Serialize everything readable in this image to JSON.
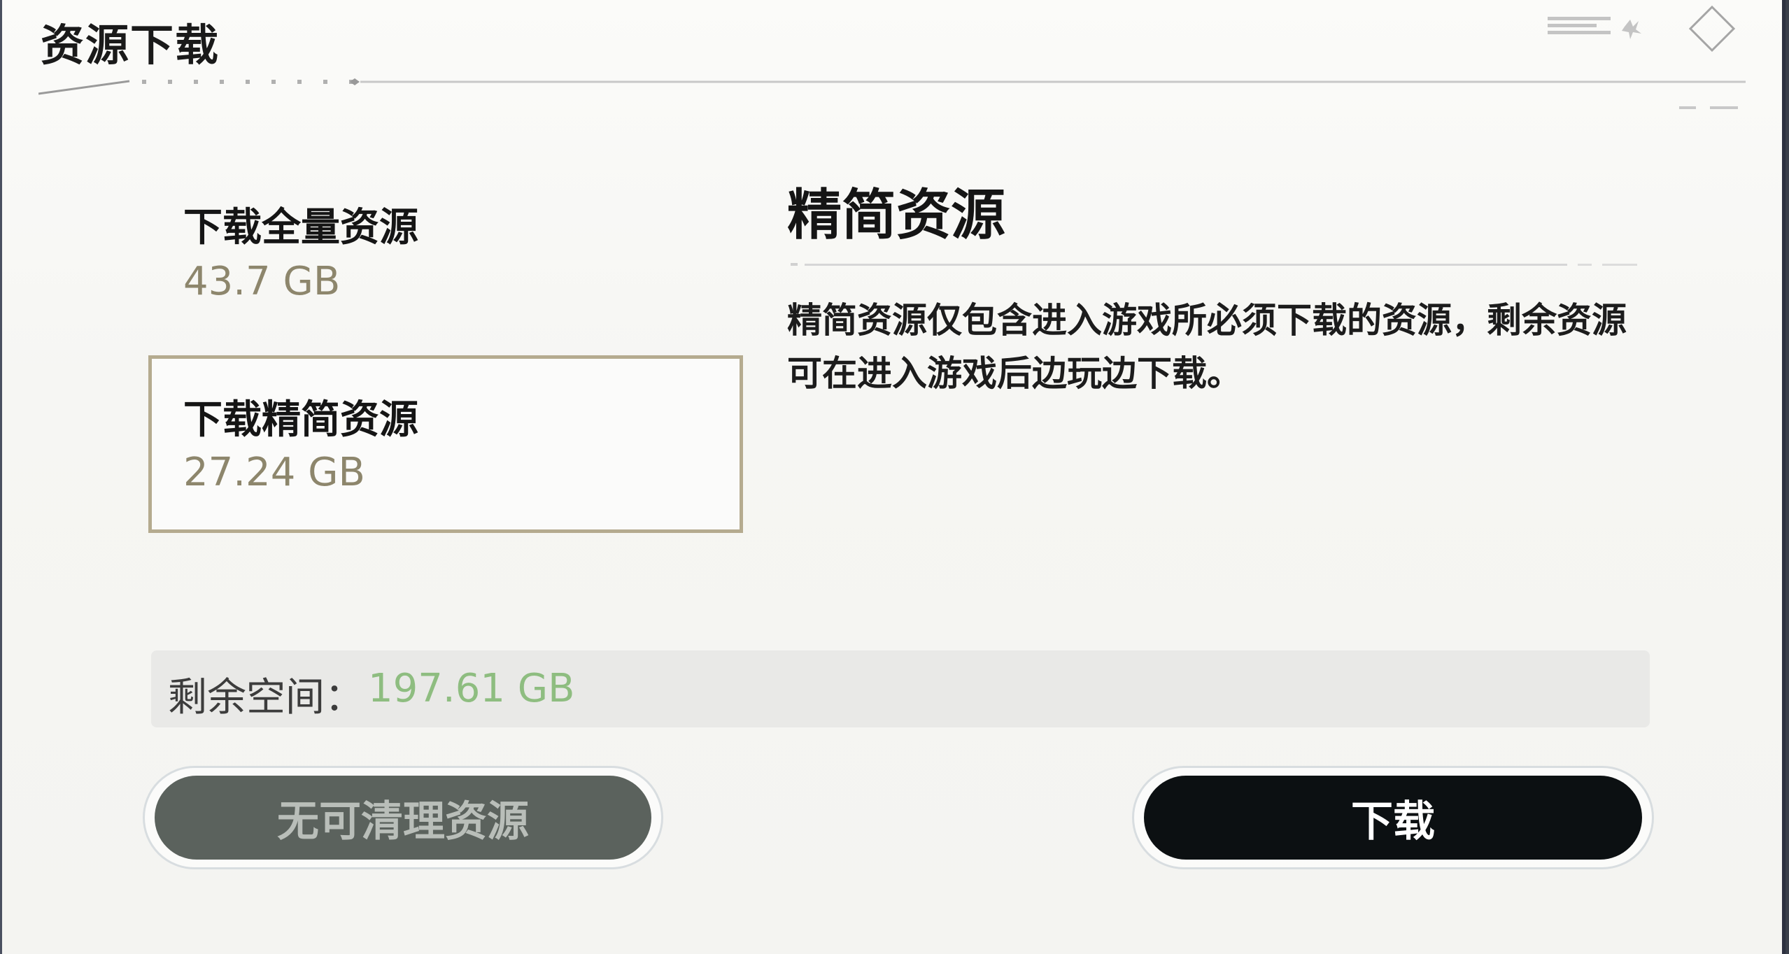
{
  "header": {
    "title": "资源下载"
  },
  "options": [
    {
      "label": "下载全量资源",
      "size": "43.7 GB",
      "selected": false
    },
    {
      "label": "下载精简资源",
      "size": "27.24 GB",
      "selected": true
    }
  ],
  "detail": {
    "title": "精简资源",
    "description": "精简资源仅包含进入游戏所必须下载的资源，剩余资源可在进入游戏后边玩边下载。"
  },
  "storage": {
    "label": "剩余空间：",
    "value": "197.61 GB"
  },
  "buttons": {
    "clean_label": "无可清理资源",
    "download_label": "下载"
  },
  "colors": {
    "accent_gold": "#8d866c",
    "selection_border": "#b5ab8f",
    "space_value": "#8ebd80",
    "primary_button": "#0c1012",
    "disabled_button": "#5b625d"
  }
}
